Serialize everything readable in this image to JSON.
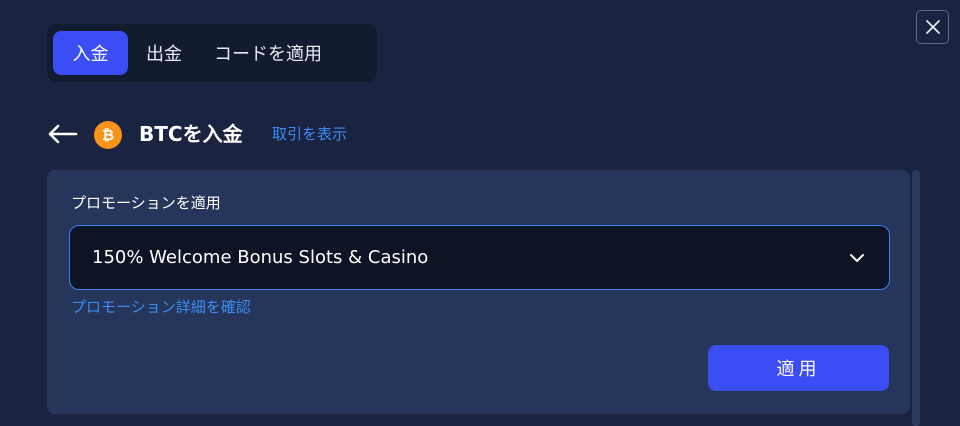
{
  "tabs": [
    {
      "label": "入金",
      "active": true
    },
    {
      "label": "出金",
      "active": false
    },
    {
      "label": "コードを適用",
      "active": false
    }
  ],
  "close_icon": "close-icon",
  "header": {
    "back_icon": "arrow-left-icon",
    "coin_icon": "bitcoin-icon",
    "coin_symbol": "₿",
    "title": "BTCを入金",
    "transactions_link": "取引を表示"
  },
  "promo": {
    "label": "プロモーションを適用",
    "selected": "150% Welcome Bonus Slots & Casino",
    "details_link": "プロモーション詳細を確認",
    "apply_label": "適用"
  },
  "colors": {
    "accent": "#3b4ef5",
    "link": "#3d8cf5",
    "btc": "#f7931a",
    "background": "#1a2440",
    "panel": "#26355a"
  }
}
